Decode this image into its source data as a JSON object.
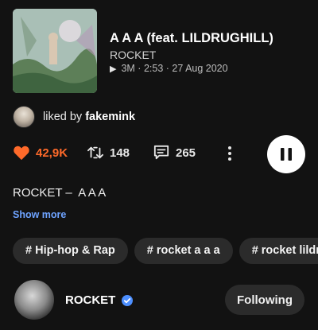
{
  "track": {
    "title": "A A A (feat. LILDRUGHILL)",
    "artist": "ROCKET",
    "plays": "3M",
    "duration": "2:53",
    "date": "27 Aug 2020",
    "meta_line": "3M · 2:53 · 27 Aug 2020"
  },
  "liked_by": {
    "prefix": "liked by",
    "user": "fakemink"
  },
  "actions": {
    "likes": "42,9K",
    "reposts": "148",
    "comments": "265",
    "like_color": "#ff6a2a"
  },
  "description": {
    "text": "ROCKET –  A A A",
    "show_more": "Show more"
  },
  "tags": [
    "# Hip-hop & Rap",
    "# rocket a a a",
    "# rocket lildrughill"
  ],
  "artist_row": {
    "name": "ROCKET",
    "follow_label": "Following"
  },
  "icons": [
    "play-icon",
    "heart-icon",
    "repost-icon",
    "comment-icon",
    "more-icon",
    "pause-icon",
    "verified-icon"
  ]
}
